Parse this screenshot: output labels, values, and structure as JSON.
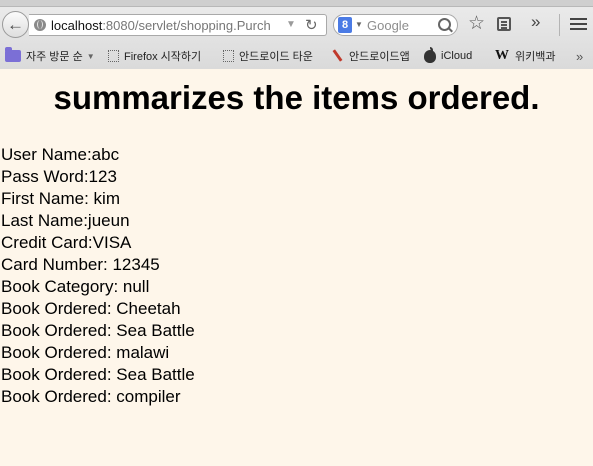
{
  "browser": {
    "url_host": "localhost",
    "url_rest": ":8080/servlet/shopping.Purch",
    "search_placeholder": "Google",
    "search_engine_glyph": "8",
    "bookmarks": [
      {
        "label": "자주 방문 순",
        "icon": "folder-icon"
      },
      {
        "label": "Firefox 시작하기",
        "icon": "dotted-icon"
      },
      {
        "label": "안드로이드 타운",
        "icon": "dotted-icon"
      },
      {
        "label": "안드로이드앱",
        "icon": "pen-icon"
      },
      {
        "label": "iCloud",
        "icon": "apple-icon"
      },
      {
        "label": "위키백과",
        "icon": "wiki-icon"
      }
    ],
    "wiki_glyph": "W",
    "more_glyph": "»"
  },
  "page": {
    "heading": "summarizes the items ordered.",
    "lines": [
      "User Name:abc",
      "Pass Word:123",
      "First Name: kim",
      "Last Name:jueun",
      "Credit Card:VISA",
      "Card Number: 12345",
      "Book Category: null",
      "Book Ordered: Cheetah",
      "Book Ordered: Sea Battle",
      "Book Ordered: malawi",
      "Book Ordered: Sea Battle",
      "Book Ordered: compiler"
    ]
  },
  "colors": {
    "page_background": "#fef6ea",
    "text": "#000000"
  }
}
